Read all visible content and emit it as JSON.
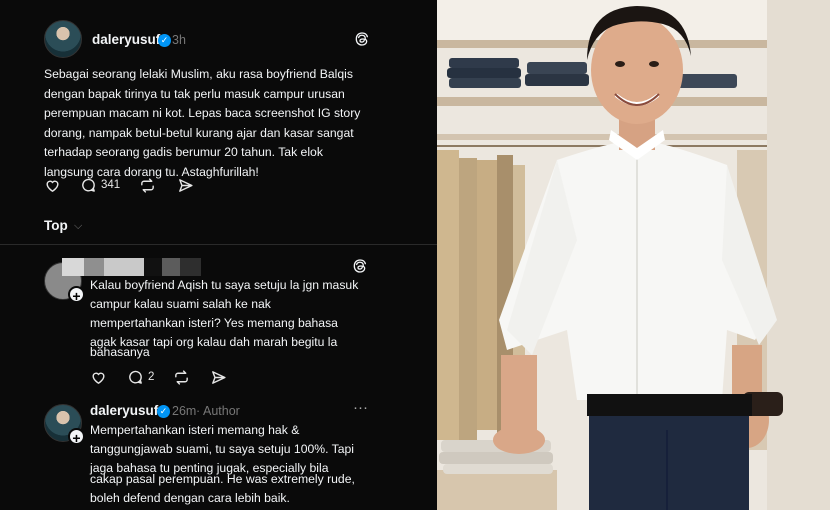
{
  "post": {
    "username": "daleryusuf",
    "time": "3h",
    "text": "Sebagai seorang lelaki Muslim, aku rasa boyfriend Balqis dengan bapak tirinya tu tak perlu masuk campur urusan perempuan macam ni kot. Lepas baca screenshot IG story dorang, nampak betul-betul kurang ajar dan kasar sangat terhadap seorang gadis berumur 20 tahun. Tak elok langsung cara dorang tu. Astaghfurillah!",
    "lines": [
      "Sebagai seorang lelaki Muslim, aku rasa boyfriend Balqis",
      "dengan bapak tirinya tu tak perlu masuk campur urusan",
      "perempuan macam ni kot. Lepas baca screenshot IG story",
      "dorang, nampak betul-betul kurang ajar dan kasar sangat",
      "terhadap seorang gadis berumur 20 tahun. Tak elok",
      "langsung cara dorang tu. Astaghfurillah!"
    ],
    "reply_count": "341"
  },
  "sort": {
    "label": "Top"
  },
  "comment": {
    "lines": [
      "Kalau boyfriend Aqish tu saya setuju la jgn masuk",
      "campur kalau suami salah ke nak",
      "mempertahankan isteri? Yes memang bahasa",
      "agak kasar tapi org kalau dah marah begitu la",
      "bahasanya"
    ],
    "reply_count": "2"
  },
  "author_reply": {
    "username": "daleryusuf",
    "time": "26m",
    "badge": "Author",
    "more": "···",
    "lines": [
      "Mempertahankan isteri memang hak &",
      "tanggungjawab suami, tu saya setuju 100%. Tapi",
      "jaga bahasa tu penting jugak, especially bila",
      "cakap pasal perempuan. He was extremely rude,",
      "boleh defend dengan cara lebih baik."
    ]
  },
  "colors": {
    "background": "#0a0a0a",
    "text": "#f3f5f7",
    "muted": "#777777",
    "verified": "#0095f6"
  },
  "icons": [
    "threads-logo-icon",
    "heart-icon",
    "comment-icon",
    "repost-icon",
    "share-icon",
    "verified-badge-icon",
    "follow-plus-icon",
    "chevron-down-icon",
    "more-icon"
  ]
}
